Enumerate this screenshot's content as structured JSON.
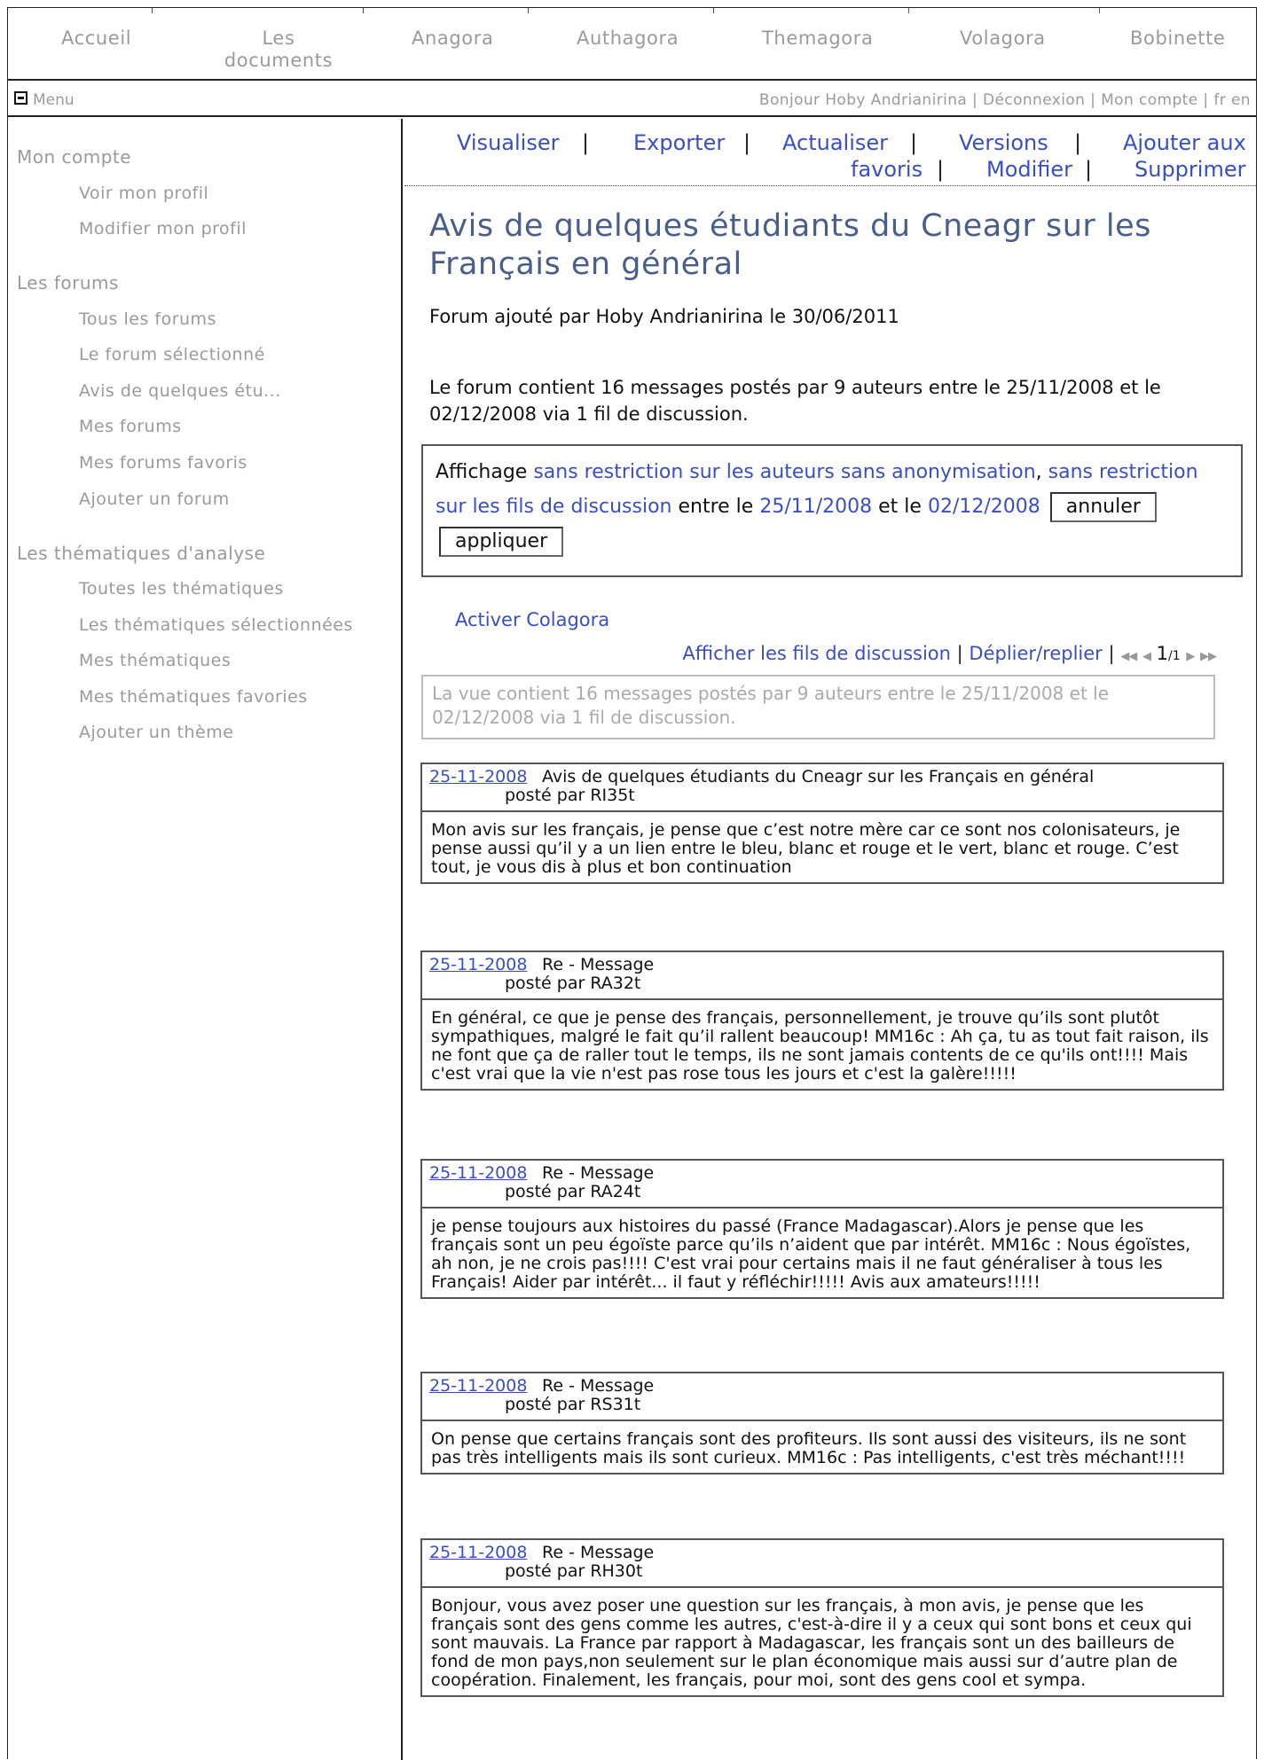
{
  "nav": {
    "home": "Accueil",
    "documents_1": "Les",
    "documents_2": "documents",
    "anagora": "Anagora",
    "authagora": "Authagora",
    "themagora": "Themagora",
    "volagora": "Volagora",
    "bobinette": "Bobinette"
  },
  "menubar": {
    "menu": "Menu",
    "greeting": "Bonjour Hoby Andrianirina",
    "logout": "Déconnexion",
    "account": "Mon compte",
    "lang_fr": "fr",
    "lang_en": "en",
    "sep": "|"
  },
  "sidebar": {
    "account_heading": "Mon compte",
    "view_profile": "Voir mon profil",
    "edit_profile": "Modifier mon profil",
    "forums_heading": "Les forums",
    "all_forums": "Tous les forums",
    "selected_forum": "Le forum sélectionné",
    "current_forum": "Avis de quelques étu...",
    "my_forums": "Mes forums",
    "fav_forums": "Mes forums favoris",
    "add_forum": "Ajouter un forum",
    "themes_heading": "Les thématiques d'analyse",
    "all_themes": "Toutes les thématiques",
    "selected_themes": "Les thématiques sélectionnées",
    "my_themes": "Mes thématiques",
    "fav_themes": "Mes thématiques favories",
    "add_theme": "Ajouter un thème"
  },
  "actions": {
    "view": "Visualiser",
    "export": "Exporter",
    "refresh": "Actualiser",
    "versions": "Versions",
    "add_fav_1": "Ajouter aux",
    "add_fav_2": "favoris",
    "edit": "Modifier",
    "delete": "Supprimer",
    "pipe": "|"
  },
  "forum": {
    "title": "Avis de quelques étudiants du Cneagr sur les Français en général",
    "meta": "Forum ajouté par Hoby Andrianirina le 30/06/2011",
    "summary": "Le forum contient 16 messages postés par 9 auteurs entre le 25/11/2008 et le 02/12/2008 via 1 fil de discussion."
  },
  "filter": {
    "prefix": "Affichage",
    "authors": "sans restriction sur les auteurs sans anonymisation",
    "comma": ",",
    "threads": "sans restriction sur les fils de discussion",
    "between": "entre le",
    "date_from": "25/11/2008",
    "and": "et le",
    "date_to": "02/12/2008",
    "cancel": "annuler",
    "apply": "appliquer"
  },
  "colagora": "Activer Colagora",
  "threadbar": {
    "show_threads": "Afficher les fils de discussion",
    "toggle": "Déplier/replier",
    "pipe": "|",
    "first": "◀◀",
    "prev": "◀",
    "page": "1",
    "total": "/1",
    "next": "▶",
    "last": "▶▶"
  },
  "view_info": "La vue contient 16 messages postés par 9 auteurs entre le 25/11/2008 et le 02/12/2008 via 1 fil de discussion.",
  "messages": [
    {
      "date": "25-11-2008",
      "title": "Avis de quelques étudiants du Cneagr sur les Français en général",
      "author": "posté par RI35t",
      "body": "Mon avis sur les français, je pense que c’est notre mère car ce sont nos colonisateurs, je pense aussi qu’il y a un lien entre le bleu, blanc et rouge et le vert, blanc et rouge. C’est tout, je vous dis à plus et bon continuation"
    },
    {
      "date": "25-11-2008",
      "title": "Re - Message",
      "author": "posté par RA32t",
      "body": "En général, ce que je pense des français, personnellement, je trouve qu’ils sont plutôt sympathiques, malgré le fait qu’il rallent beaucoup! MM16c : Ah ça, tu as tout fait raison, ils ne font que ça de raller tout le temps, ils ne sont jamais contents de ce qu'ils ont!!!! Mais c'est vrai que la vie n'est pas rose tous les jours et c'est la galère!!!!!"
    },
    {
      "date": "25-11-2008",
      "title": "Re - Message",
      "author": "posté par RA24t",
      "body": "je pense toujours aux histoires du passé (France Madagascar).Alors je pense que les français sont un peu égoïste parce qu’ils n’aident que par intérêt. MM16c : Nous égoïstes, ah non, je ne crois pas!!!! C'est vrai pour certains mais il ne faut généraliser à tous les Français! Aider par intérêt... il faut y réfléchir!!!!! Avis aux amateurs!!!!!"
    },
    {
      "date": "25-11-2008",
      "title": "Re - Message",
      "author": "posté par RS31t",
      "body": "On pense que certains français sont des profiteurs. Ils sont aussi des visiteurs, ils ne sont pas très intelligents mais ils sont curieux. MM16c : Pas intelligents, c'est très méchant!!!!"
    },
    {
      "date": "25-11-2008",
      "title": "Re - Message",
      "author": "posté par RH30t",
      "body": "Bonjour, vous avez poser une question sur les français, à mon avis, je pense que les français sont des gens comme les autres, c'est-à-dire il y a ceux qui sont bons et ceux qui sont mauvais. La France par rapport à Madagascar, les français sont un des bailleurs de fond de mon pays,non seulement sur le plan économique mais aussi sur d’autre plan de coopération. Finalement, les français, pour moi, sont des gens cool et sympa."
    }
  ]
}
